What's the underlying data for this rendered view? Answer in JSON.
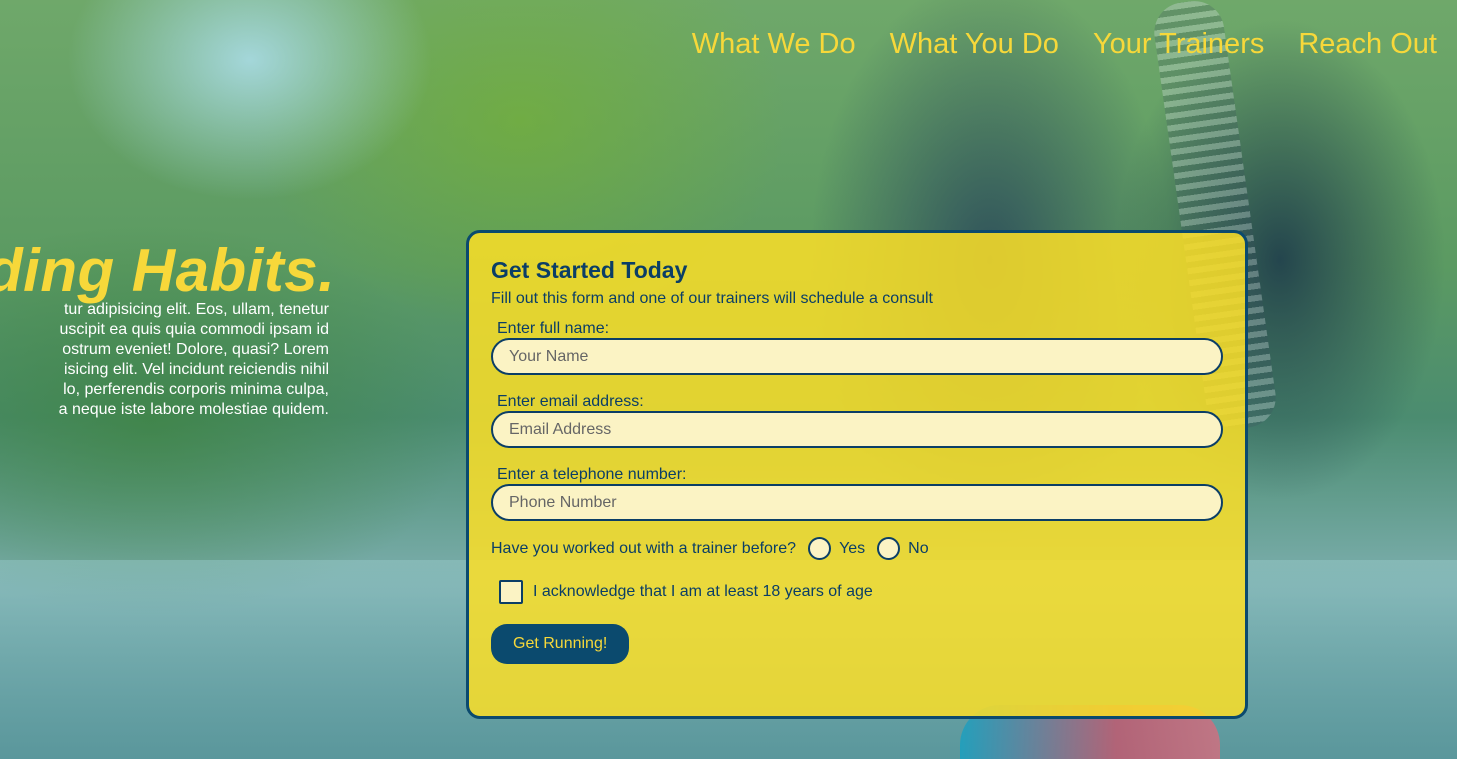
{
  "nav": {
    "items": [
      "What We Do",
      "What You Do",
      "Your Trainers",
      "Reach Out"
    ]
  },
  "hero": {
    "headline": "ding Habits.",
    "intro_lines": [
      "tur adipisicing elit. Eos, ullam, tenetur",
      "uscipit ea quis quia commodi ipsam id",
      "ostrum eveniet! Dolore, quasi? Lorem",
      "isicing elit. Vel incidunt reiciendis nihil",
      "lo, perferendis corporis minima culpa,",
      "a neque iste labore molestiae quidem."
    ]
  },
  "form": {
    "title": "Get Started Today",
    "subtitle": "Fill out this form and one of our trainers will schedule a consult",
    "name_label": "Enter full name:",
    "name_placeholder": "Your Name",
    "email_label": "Enter email address:",
    "email_placeholder": "Email Address",
    "phone_label": "Enter a telephone number:",
    "phone_placeholder": "Phone Number",
    "trainer_question": "Have you worked out with a trainer before?",
    "yes_label": "Yes",
    "no_label": "No",
    "age_ack": "I acknowledge that I am at least 18 years of age",
    "submit_label": "Get Running!"
  },
  "colors": {
    "accent_yellow": "#f7d83a",
    "navy": "#0b3e66",
    "card_bg": "#fade28"
  }
}
